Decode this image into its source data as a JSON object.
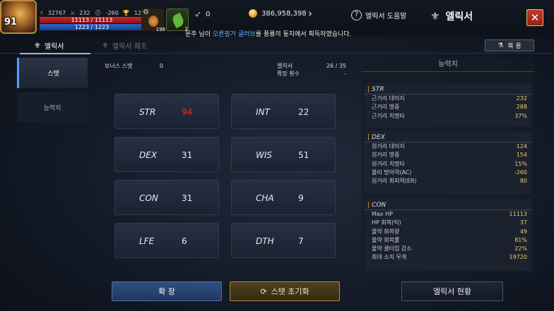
{
  "player": {
    "level": "91",
    "stat1": "32767",
    "stat2": "232",
    "stat3": "-260",
    "stat4": "12",
    "hp": "11113 / 11113",
    "mp": "1223 / 1223"
  },
  "buffs": [
    {
      "icon": "potion-icon",
      "count": "198"
    },
    {
      "icon": "leaf-icon",
      "count": "2"
    }
  ],
  "currency": {
    "feather": "0",
    "gold": "386,958,398"
  },
  "header": {
    "help_label": "엘릭서 도움말",
    "title": "엘릭서",
    "close_symbol": "✕"
  },
  "notice": {
    "prefix": "문주 님이 ",
    "item": "오른핑거 글러브",
    "suffix": "를 풍룡의 둥지에서 획득하였습니다."
  },
  "tabs": {
    "elixir": "엘릭서",
    "craft": "엘릭서 제조",
    "restore": "복 용"
  },
  "sidenav": {
    "stat": "스탯",
    "ability": "능력치"
  },
  "bonus": {
    "label": "보너스 스탯",
    "value": "0"
  },
  "elixir_info": {
    "label": "엘릭서",
    "value": "26 / 35",
    "expand_label": "확장 횟수",
    "expand_value": "-"
  },
  "stats": [
    {
      "name": "STR",
      "value": "94",
      "highlight": true
    },
    {
      "name": "INT",
      "value": "22"
    },
    {
      "name": "DEX",
      "value": "31"
    },
    {
      "name": "WIS",
      "value": "51"
    },
    {
      "name": "CON",
      "value": "31"
    },
    {
      "name": "CHA",
      "value": "9"
    },
    {
      "name": "LFE",
      "value": "6"
    },
    {
      "name": "DTH",
      "value": "7"
    }
  ],
  "panel": {
    "title": "능력치",
    "groups": [
      {
        "name": "STR",
        "rows": [
          {
            "label": "근거리 대미지",
            "value": "232"
          },
          {
            "label": "근거리 명중",
            "value": "288"
          },
          {
            "label": "근거리 치명타",
            "value": "37%"
          }
        ]
      },
      {
        "name": "DEX",
        "rows": [
          {
            "label": "원거리 대미지",
            "value": "124"
          },
          {
            "label": "원거리 명중",
            "value": "154"
          },
          {
            "label": "원거리 치명타",
            "value": "15%"
          },
          {
            "label": "물리 방어력(AC)",
            "value": "-260"
          },
          {
            "label": "원거리 회피력(ER)",
            "value": "80"
          }
        ]
      },
      {
        "name": "CON",
        "rows": [
          {
            "label": "Max HP",
            "value": "11113"
          },
          {
            "label": "HP 회복(틱)",
            "value": "37"
          },
          {
            "label": "물약 회복량",
            "value": "49"
          },
          {
            "label": "물약 회복률",
            "value": "81%"
          },
          {
            "label": "물약 쿨타임 감소",
            "value": "22%"
          },
          {
            "label": "최대 소지 무게",
            "value": "19720"
          }
        ]
      }
    ]
  },
  "buttons": {
    "expand": "확 장",
    "reset": "스탯 초기화",
    "status": "엘릭서 현황"
  },
  "colors": {
    "highlight_value": "#ef2d2d",
    "panel_value": "#f3c96a",
    "group_marker": "#e39a2a",
    "active_tab_bar": "#5a9bff"
  }
}
